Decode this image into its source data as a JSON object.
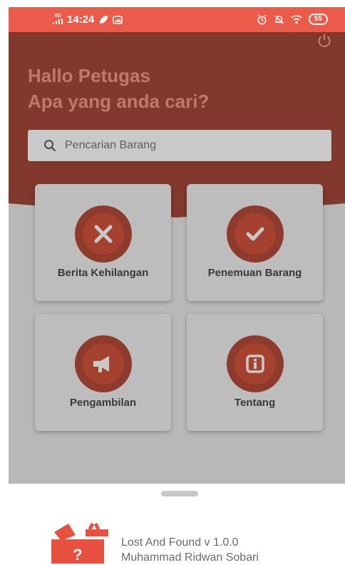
{
  "status_bar": {
    "network": "4G",
    "time": "14:24",
    "battery": "55"
  },
  "header": {
    "greeting_line1": "Hallo Petugas",
    "greeting_line2": "Apa yang anda cari?"
  },
  "search": {
    "placeholder": "Pencarian Barang"
  },
  "menu": [
    {
      "label": "Berita Kehilangan",
      "icon": "close-x-icon"
    },
    {
      "label": "Penemuan Barang",
      "icon": "checkmark-icon"
    },
    {
      "label": "Pengambilan",
      "icon": "megaphone-icon"
    },
    {
      "label": "Tentang",
      "icon": "info-icon"
    }
  ],
  "footer": {
    "app_version": "Lost And Found v 1.0.0",
    "author": "Muhammad Ridwan Sobari"
  },
  "colors": {
    "status_bar": "#ec5a4a",
    "hero_dimmed": "#82382c",
    "accent": "#e8503f"
  }
}
